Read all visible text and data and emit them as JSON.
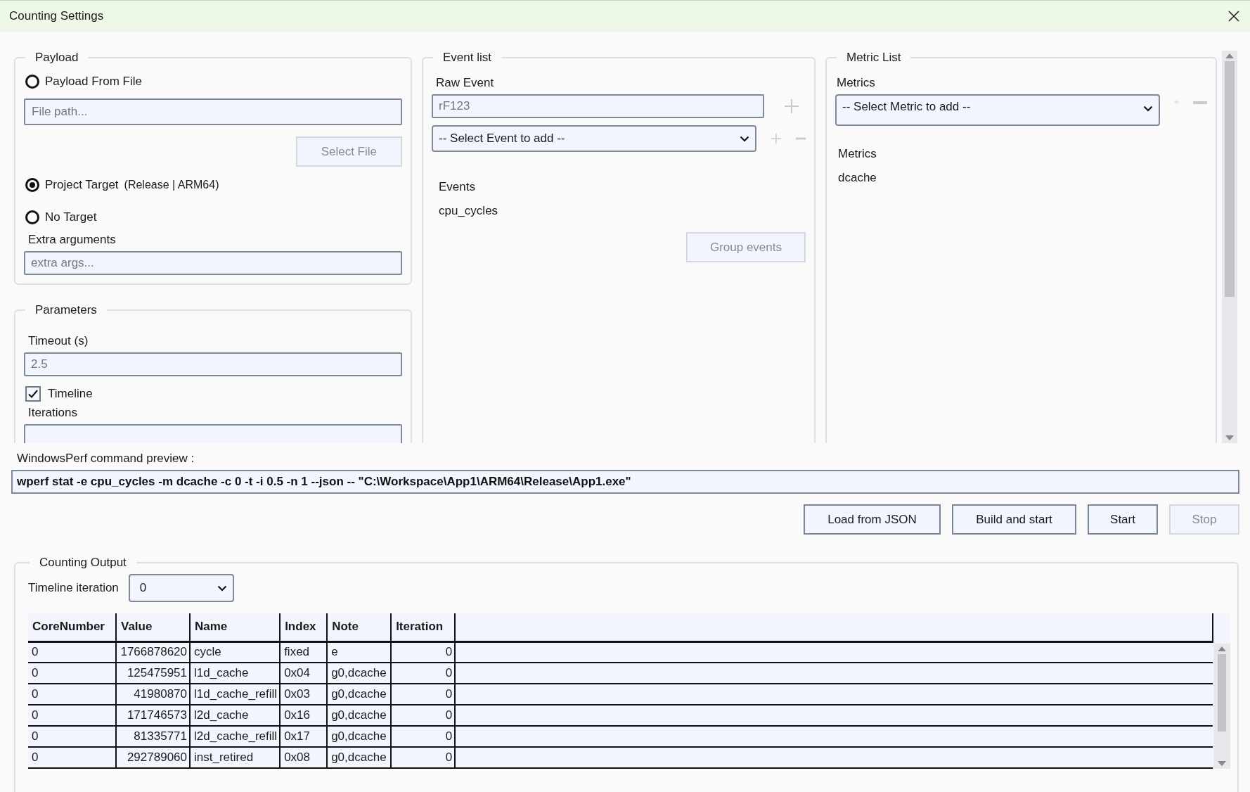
{
  "window": {
    "title": "Counting Settings"
  },
  "payload": {
    "title": "Payload",
    "options": [
      {
        "label": "Payload From File",
        "selected": false
      },
      {
        "label": "Project Target",
        "selected": true,
        "detail": "(Release | ARM64)"
      },
      {
        "label": "No Target",
        "selected": false
      }
    ],
    "file_path": {
      "placeholder": "File path..."
    },
    "select_file_button": {
      "label": "Select File",
      "disabled": true
    },
    "extra_arguments": {
      "label": "Extra arguments",
      "placeholder": "extra args..."
    }
  },
  "parameters": {
    "title": "Parameters",
    "timeout": {
      "label": "Timeout (s)",
      "placeholder": "2.5"
    },
    "timeline": {
      "label": "Timeline",
      "checked": true
    },
    "iterations": {
      "label": "Iterations"
    }
  },
  "event_list": {
    "title": "Event list",
    "raw_event": {
      "label": "Raw Event",
      "placeholder": "rF123"
    },
    "select_event": {
      "value": "-- Select Event to add --"
    },
    "events_label": "Events",
    "events": [
      "cpu_cycles"
    ],
    "group_events_button": {
      "label": "Group events",
      "disabled": true
    }
  },
  "metric_list": {
    "title": "Metric List",
    "metrics_label": "Metrics",
    "select_metric": {
      "value": "-- Select Metric to add --"
    },
    "list_label": "Metrics",
    "metrics": [
      "dcache"
    ]
  },
  "command_preview": {
    "label": "WindowsPerf command preview :",
    "value": "wperf stat -e cpu_cycles -m dcache -c 0 -t -i 0.5 -n 1 --json -- \"C:\\Workspace\\App1\\ARM64\\Release\\App1.exe\""
  },
  "buttons": [
    {
      "label": "Load from JSON",
      "disabled": false
    },
    {
      "label": "Build and start",
      "disabled": false
    },
    {
      "label": "Start",
      "disabled": false
    },
    {
      "label": "Stop",
      "disabled": true
    }
  ],
  "counting_output": {
    "title": "Counting Output",
    "timeline_iteration": {
      "label": "Timeline iteration",
      "value": "0"
    },
    "table": {
      "columns": [
        "CoreNumber",
        "Value",
        "Name",
        "Index",
        "Note",
        "Iteration"
      ],
      "rows": [
        [
          "0",
          "1766878620",
          "cycle",
          "fixed",
          "e",
          "0"
        ],
        [
          "0",
          "125475951",
          "l1d_cache",
          "0x04",
          "g0,dcache",
          "0"
        ],
        [
          "0",
          "41980870",
          "l1d_cache_refill",
          "0x03",
          "g0,dcache",
          "0"
        ],
        [
          "0",
          "171746573",
          "l2d_cache",
          "0x16",
          "g0,dcache",
          "0"
        ],
        [
          "0",
          "81335771",
          "l2d_cache_refill",
          "0x17",
          "g0,dcache",
          "0"
        ],
        [
          "0",
          "292789060",
          "inst_retired",
          "0x08",
          "g0,dcache",
          "0"
        ]
      ]
    }
  }
}
